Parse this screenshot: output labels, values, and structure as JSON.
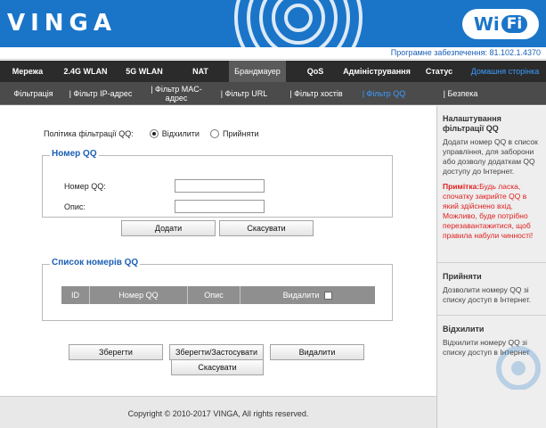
{
  "header": {
    "brand": "VINGA",
    "wifi_logo_left": "Wi",
    "wifi_logo_right": "Fi",
    "firmware": "Програмне забезпечення: 81.102.1.4370"
  },
  "nav": {
    "items": [
      {
        "label": "Мережа"
      },
      {
        "label": "2.4G WLAN"
      },
      {
        "label": "5G WLAN"
      },
      {
        "label": "NAT"
      },
      {
        "label": "Брандмауер"
      },
      {
        "label": "QoS"
      },
      {
        "label": "Адміністрування"
      },
      {
        "label": "Статус"
      },
      {
        "label": "Домашня сторінка"
      }
    ],
    "active": "Брандмауер"
  },
  "subnav": {
    "items": [
      {
        "label": "Фільтрація"
      },
      {
        "label": "| Фільтр IP-адрес"
      },
      {
        "label": "| Фільтр MAC-адрес"
      },
      {
        "label": "| Фільтр URL"
      },
      {
        "label": "| Фільтр хостів"
      },
      {
        "label": "| Фільтр QQ"
      },
      {
        "label": "| Безпека"
      }
    ],
    "active": "Фільтр QQ"
  },
  "policy": {
    "label": "Політика фільтрації QQ:",
    "option_reject": "Відхилити",
    "option_accept": "Прийняти",
    "selected": "Відхилити"
  },
  "qq_form": {
    "legend": "Номер QQ",
    "number_label": "Номер QQ:",
    "number_value": "",
    "desc_label": "Опис:",
    "desc_value": "",
    "add_button": "Додати",
    "cancel_button": "Скасувати"
  },
  "qq_list": {
    "legend": "Список номерів QQ",
    "columns": [
      "ID",
      "Номер QQ",
      "Опис",
      "Видалити"
    ]
  },
  "actions": {
    "save": "Зберегти",
    "save_apply": "Зберегти/Застосувати",
    "delete": "Видалити",
    "cancel": "Скасувати"
  },
  "footer": {
    "copyright": "Copyright © 2010-2017 VINGA, All rights reserved."
  },
  "help": {
    "title": "Налаштування фільтрації QQ",
    "text": "Додати номер QQ в список управління, для заборони або дозволу додаткам QQ доступу до Інтернет.",
    "note_label": "Примітка:",
    "note_text": "Будь ласка, спочатку закрийте QQ в який здійснено вхід. Можливо, буде потрібно перезавантажитися, щоб правила набули чинності!",
    "accept_title": "Прийняти",
    "accept_text": "Дозволити номеру QQ зі списку доступ в Інтернет.",
    "reject_title": "Відхилити",
    "reject_text": "Відхилити номеру QQ зі списку доступ в Інтернет"
  },
  "colors": {
    "header_blue": "#1a75c9",
    "nav_dark": "#2b2b2b",
    "legend_blue": "#1a5fb4",
    "note_red": "#e02020"
  }
}
